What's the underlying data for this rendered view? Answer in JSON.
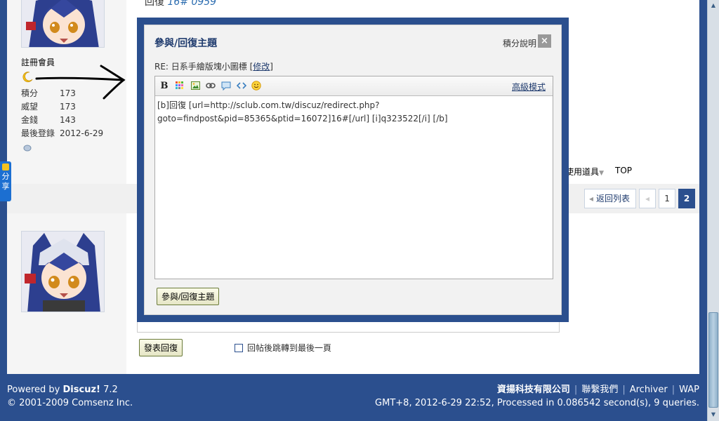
{
  "post": {
    "title_prefix": "回復",
    "title_floor": "16# 0959",
    "user1": {
      "rank": "註冊會員",
      "stats": [
        {
          "label": "積分",
          "value": "173"
        },
        {
          "label": "威望",
          "value": "173"
        },
        {
          "label": "金錢",
          "value": "143"
        },
        {
          "label": "最後登錄",
          "value": "2012-6-29"
        }
      ]
    }
  },
  "share_tab": {
    "label_1": "分",
    "label_2": "享"
  },
  "tools": {
    "use_items": "使用道具",
    "top": "TOP"
  },
  "pager": {
    "back": "返回列表",
    "page1": "1",
    "page2": "2"
  },
  "reply": {
    "submit": "發表回復",
    "redirect_option": "回帖後跳轉到最後一頁"
  },
  "modal": {
    "title": "參與/回復主題",
    "help": "積分說明",
    "close": "×",
    "subject": "RE: 日系手繪版塊小圖標",
    "edit": "修改",
    "advanced": "高級模式",
    "content": "[b]回復 [url=http://sclub.com.tw/discuz/redirect.php?\ngoto=findpost&pid=85365&ptid=16072]16#[/url] [i]q323522[/i] [/b]",
    "submit": "參與/回復主題"
  },
  "footer": {
    "powered_by": "Powered by",
    "brand": "Discuz!",
    "version": "7.2",
    "copyright": "© 2001-2009 Comsenz Inc.",
    "company": "資揚科技有限公司",
    "contact": "聯繫我們",
    "archiver": "Archiver",
    "wap": "WAP",
    "stats": "GMT+8, 2012-6-29 22:52, Processed in 0.086542 second(s), 9 queries."
  },
  "colors": {
    "frame": "#2b4f8e",
    "title": "#1f3b6e"
  }
}
